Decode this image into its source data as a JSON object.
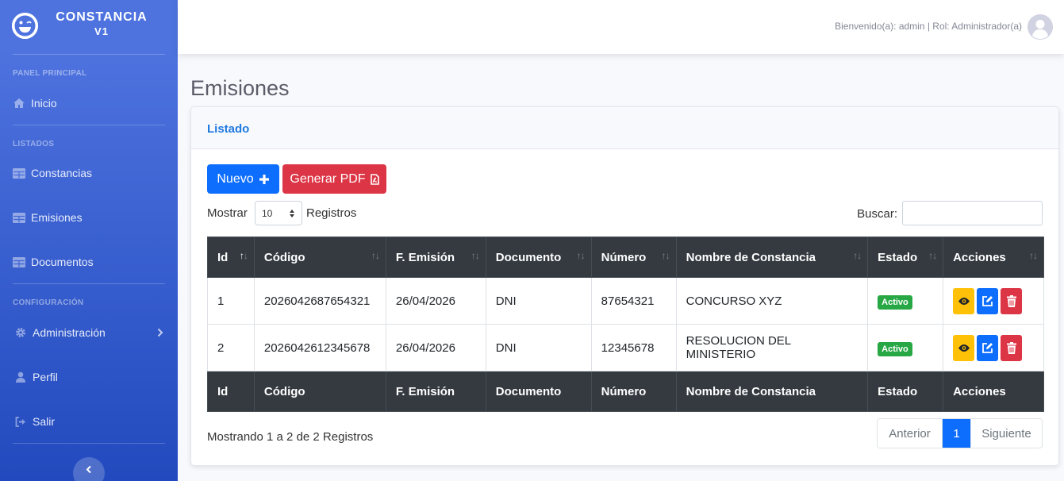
{
  "brand": {
    "title": "CONSTANCIA",
    "version": "V1"
  },
  "sidebar": {
    "headings": [
      "PANEL PRINCIPAL",
      "LISTADOS",
      "CONFIGURACIÓN"
    ],
    "items": [
      {
        "label": "Inicio",
        "icon": "home-icon"
      },
      {
        "label": "Constancias",
        "icon": "table-icon"
      },
      {
        "label": "Emisiones",
        "icon": "table-icon"
      },
      {
        "label": "Documentos",
        "icon": "table-icon"
      },
      {
        "label": "Administración",
        "icon": "gear-icon"
      },
      {
        "label": "Perfil",
        "icon": "user-icon"
      },
      {
        "label": "Salir",
        "icon": "sign-out-icon"
      }
    ]
  },
  "topbar": {
    "welcome": "Bienvenido(a): admin | Rol: Administrador(a)"
  },
  "page": {
    "title": "Emisiones"
  },
  "card": {
    "title": "Listado"
  },
  "buttons": {
    "new_label": "Nuevo",
    "pdf_label": "Generar PDF"
  },
  "length": {
    "prefix": "Mostrar",
    "value": "10",
    "suffix": "Registros"
  },
  "search": {
    "label": "Buscar:",
    "value": ""
  },
  "table": {
    "headers": [
      "Id",
      "Código",
      "F. Emisión",
      "Documento",
      "Número",
      "Nombre de Constancia",
      "Estado",
      "Acciones"
    ],
    "rows": [
      {
        "id": "1",
        "codigo": "2026042687654321",
        "fecha": "26/04/2026",
        "documento": "DNI",
        "numero": "87654321",
        "nombre": "CONCURSO XYZ",
        "estado": "Activo"
      },
      {
        "id": "2",
        "codigo": "2026042612345678",
        "fecha": "26/04/2026",
        "documento": "DNI",
        "numero": "12345678",
        "nombre": "RESOLUCION DEL MINISTERIO",
        "estado": "Activo"
      }
    ]
  },
  "info": "Mostrando 1 a 2 de 2 Registros",
  "pagination": {
    "prev": "Anterior",
    "current": "1",
    "next": "Siguiente"
  },
  "colors": {
    "sidebar_top": "#4e73df",
    "sidebar_bottom": "#224abe",
    "primary": "#0d6efd",
    "danger": "#dc3545",
    "warning": "#ffc107",
    "success": "#28a745",
    "table_head": "#343a40"
  }
}
